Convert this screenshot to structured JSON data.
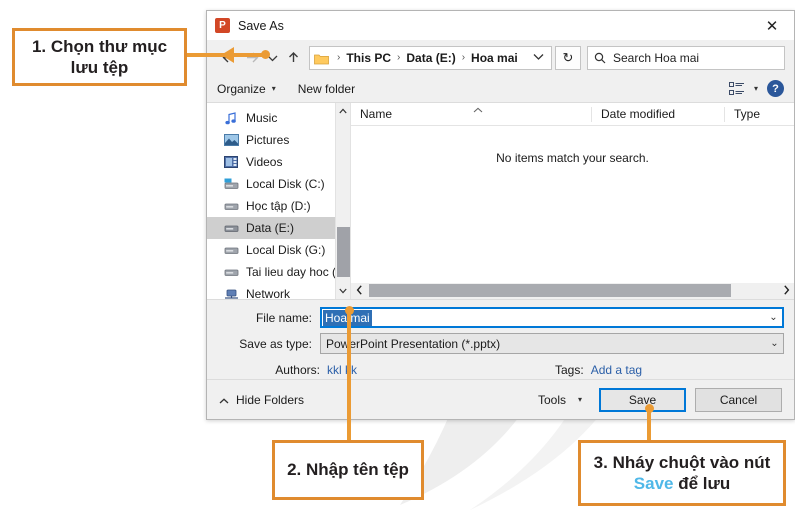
{
  "dialog": {
    "title": "Save As",
    "app_icon": "powerpoint-icon",
    "app_icon_letter": "P",
    "close_label": "✕"
  },
  "navigation": {
    "back_icon": "back-arrow-icon",
    "forward_icon": "forward-arrow-icon",
    "recent_icon": "recent-locations-icon",
    "up_icon": "up-arrow-icon",
    "breadcrumbs": [
      "This PC",
      "Data (E:)",
      "Hoa mai"
    ],
    "separator": "›",
    "dropdown_icon": "chevron-down-icon",
    "refresh_icon": "↻",
    "search": {
      "placeholder": "Search Hoa mai",
      "icon": "search-icon"
    }
  },
  "toolbar": {
    "organize_label": "Organize",
    "new_folder_label": "New folder",
    "caret": "▾",
    "view_icon": "view-layout-icon",
    "help_icon": "help-icon",
    "help_label": "?"
  },
  "tree": {
    "items": [
      {
        "label": "Music",
        "icon": "music-note-icon",
        "selected": false
      },
      {
        "label": "Pictures",
        "icon": "pictures-icon",
        "selected": false
      },
      {
        "label": "Videos",
        "icon": "videos-icon",
        "selected": false
      },
      {
        "label": "Local Disk (C:)",
        "icon": "system-drive-icon",
        "selected": false
      },
      {
        "label": "Học tập (D:)",
        "icon": "drive-icon",
        "selected": false
      },
      {
        "label": "Data (E:)",
        "icon": "drive-icon",
        "selected": true
      },
      {
        "label": "Local Disk (G:)",
        "icon": "drive-icon",
        "selected": false
      },
      {
        "label": "Tai lieu day hoc (",
        "icon": "drive-icon",
        "selected": false
      },
      {
        "label": "Network",
        "icon": "network-icon",
        "selected": false
      }
    ],
    "scroll_up_icon": "⌃",
    "scroll_down_icon": "⌄"
  },
  "file_list": {
    "columns": [
      "Name",
      "Date modified",
      "Type"
    ],
    "sort_indicator": "⌃",
    "empty_message": "No items match your search.",
    "rows": [],
    "scroll_left_icon": "‹",
    "scroll_right_icon": "›"
  },
  "form": {
    "file_name_label": "File name:",
    "file_name_value": "Hoa mai",
    "save_as_type_label": "Save as type:",
    "save_as_type_value": "PowerPoint Presentation (*.pptx)",
    "authors_label": "Authors:",
    "authors_value": "kkl kk",
    "tags_label": "Tags:",
    "tags_value": "Add a tag",
    "combo_caret": "⌄"
  },
  "footer": {
    "hide_folders_label": "Hide Folders",
    "hide_folders_icon": "chevron-up-icon",
    "tools_label": "Tools",
    "tools_caret": "▾",
    "save_label": "Save",
    "cancel_label": "Cancel"
  },
  "annotations": {
    "step1": "1. Chọn thư mục lưu tệp",
    "step2": "2. Nhập tên tệp",
    "step3_line1": "3. Nháy chuột vào nút",
    "step3_save": "Save",
    "step3_tail": " để lưu"
  },
  "colors": {
    "callout_border": "#e08b2e",
    "connector": "#eb9b34",
    "accent_blue": "#0078d7",
    "save_word_blue": "#4fb8e8",
    "selection_blue": "#2f6fb5",
    "link_blue": "#2b5fa8"
  }
}
